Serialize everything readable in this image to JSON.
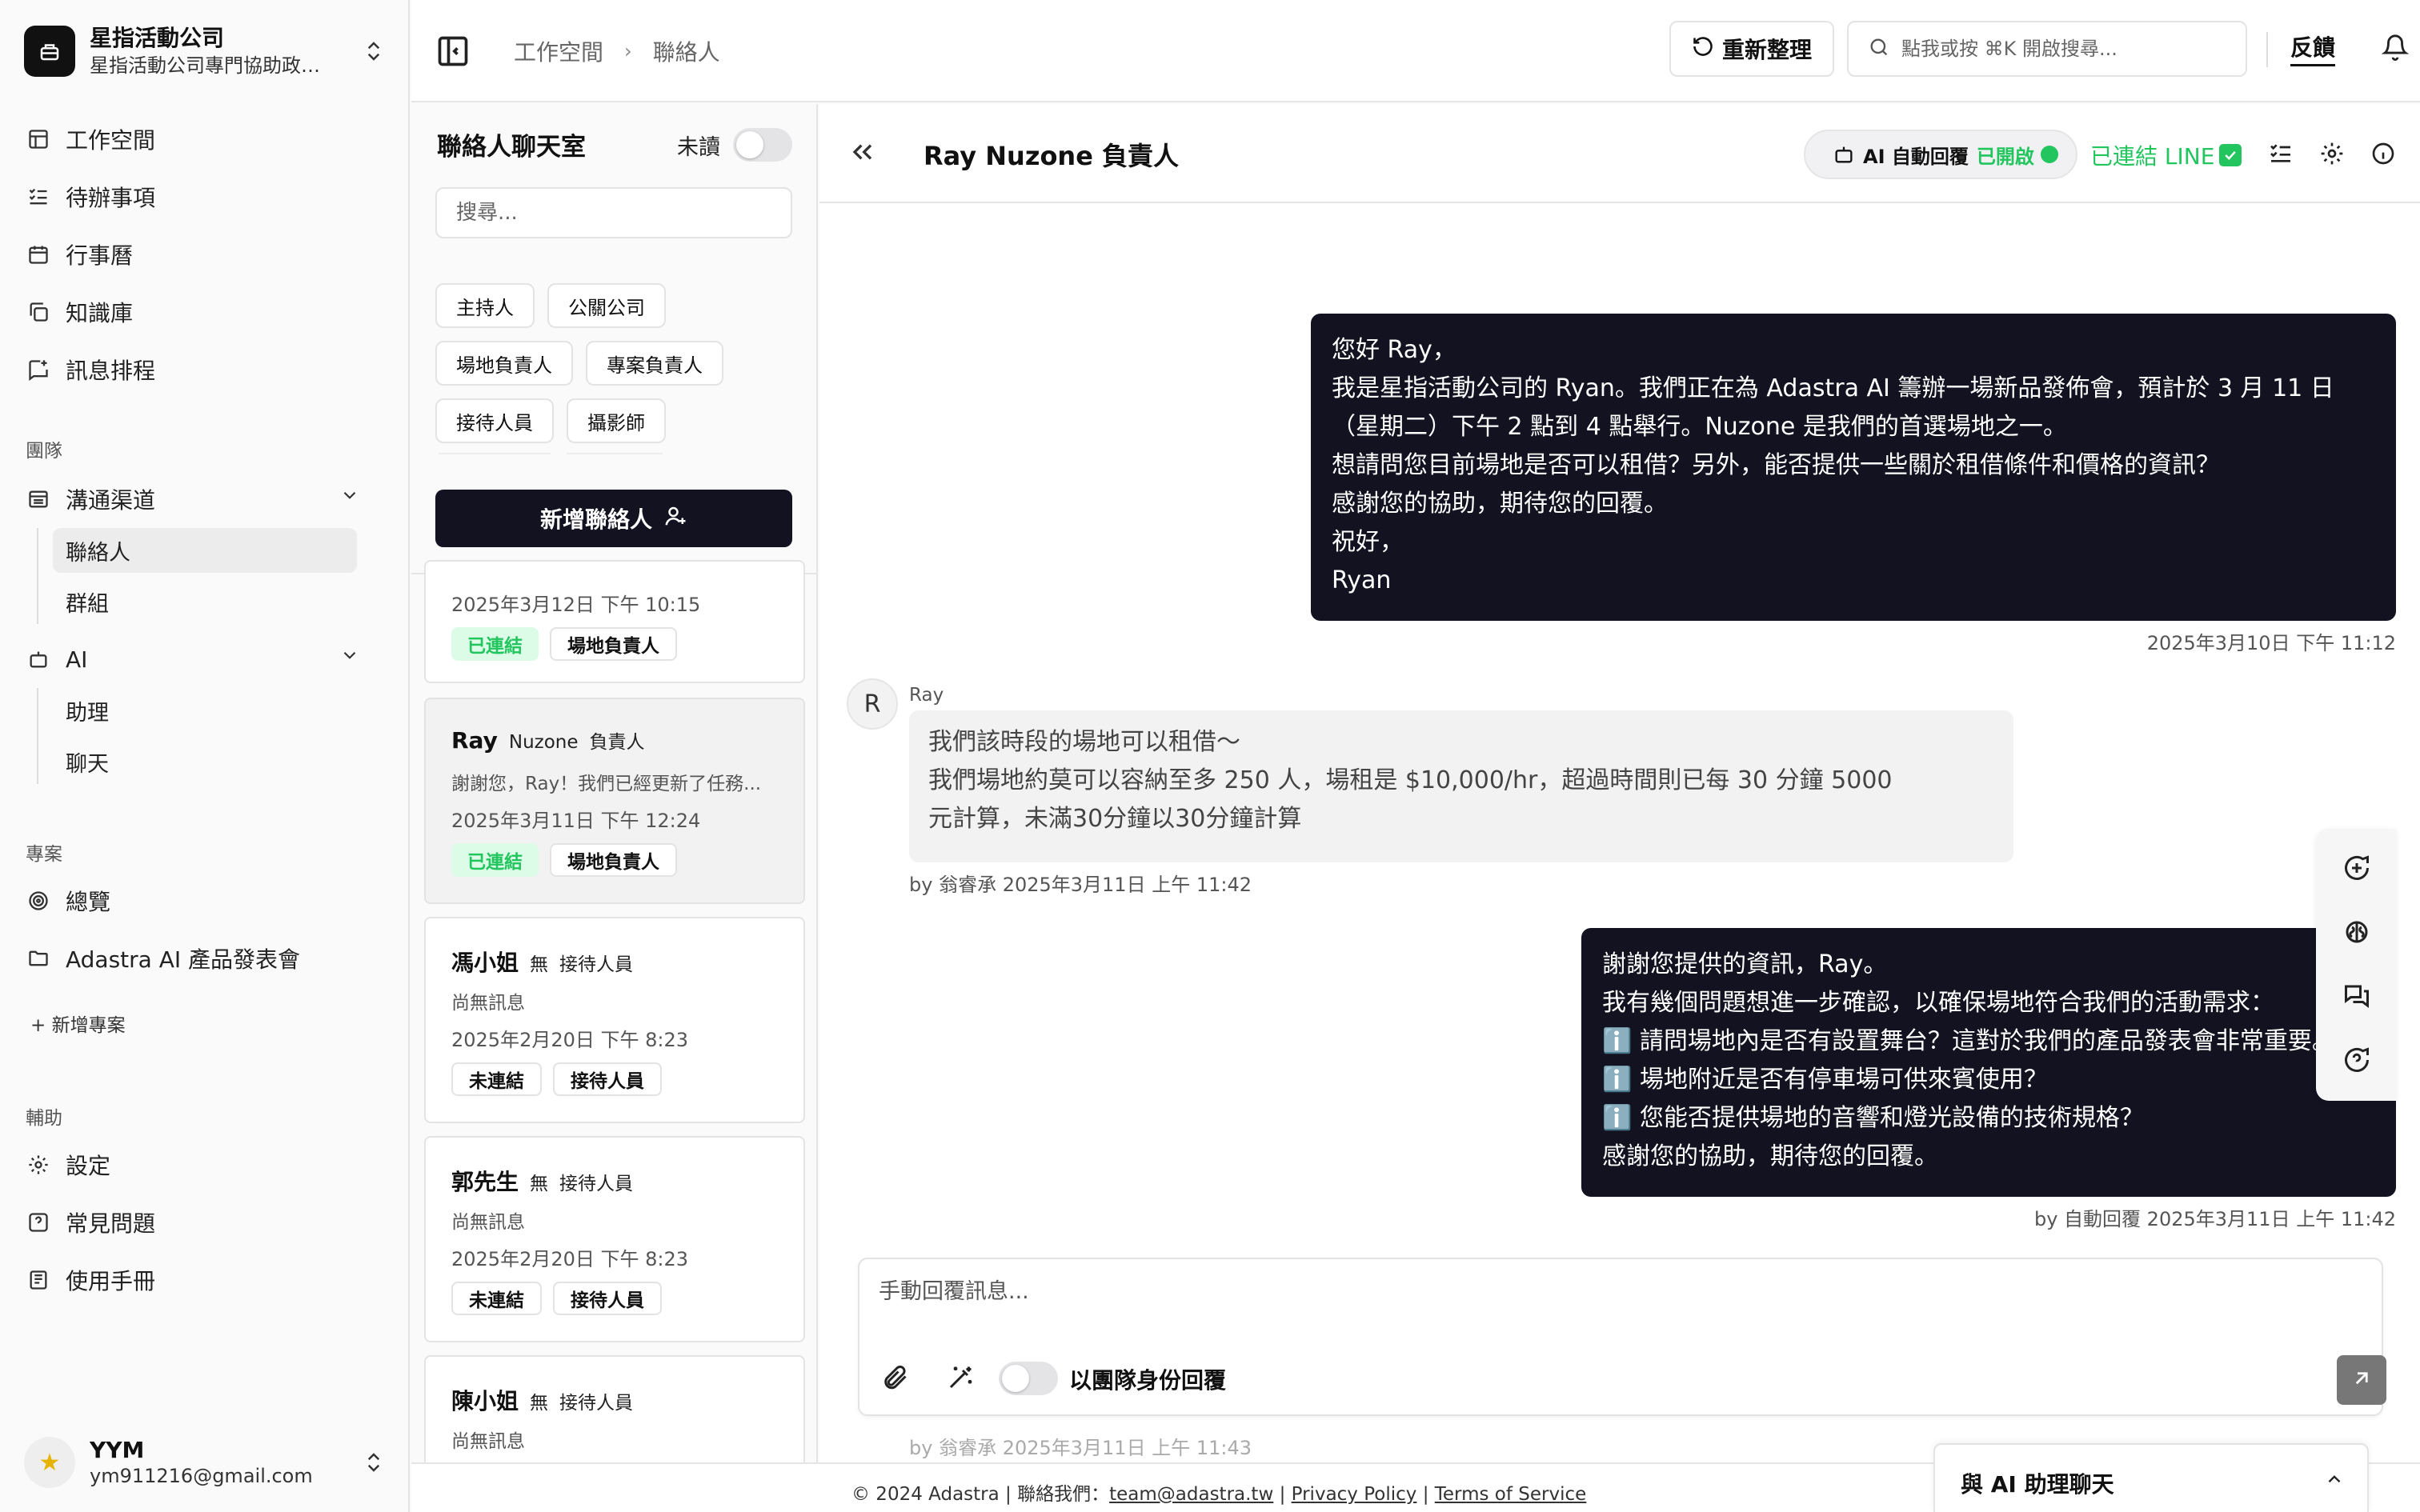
{
  "org": {
    "name": "星指活動公司",
    "description": "星指活動公司專門協助政府..."
  },
  "nav": {
    "workspace": "工作空間",
    "todo": "待辦事項",
    "calendar": "行事曆",
    "knowledge": "知識庫",
    "schedule": "訊息排程",
    "team_section": "團隊",
    "channels": "溝通渠道",
    "contacts": "聯絡人",
    "groups": "群組",
    "ai": "AI",
    "assistant": "助理",
    "chat": "聊天",
    "project_section": "專案",
    "overview": "總覽",
    "project_1": "Adastra AI 產品發表會",
    "add_project": "+ 新增專案",
    "aux_section": "輔助",
    "settings": "設定",
    "faq": "常見問題",
    "manual": "使用手冊"
  },
  "user": {
    "name": "YYM",
    "email": "ym911216@gmail.com"
  },
  "topbar": {
    "breadcrumb": [
      "工作空間",
      "聯絡人"
    ],
    "refresh_label": "重新整理",
    "search_placeholder": "點我或按 ⌘K 開啟搜尋...",
    "feedback_label": "反饋"
  },
  "contact_list": {
    "title": "聯絡人聊天室",
    "unread_label": "未讀",
    "search_placeholder": "搜尋...",
    "filters": [
      "主持人",
      "公關公司",
      "場地負責人",
      "專案負責人",
      "接待人員",
      "攝影師"
    ],
    "add_button": "新增聯絡人",
    "cards": [
      {
        "date": "2025年3月12日 下午 10:15",
        "status": "已連結",
        "role_tag": "場地負責人"
      },
      {
        "name": "Ray",
        "sub": "Nuzone",
        "role": "負責人",
        "preview": "謝謝您，Ray！我們已經更新了任務...",
        "date": "2025年3月11日 下午 12:24",
        "status": "已連結",
        "role_tag": "場地負責人"
      },
      {
        "name": "馮小姐",
        "sub": "無",
        "role": "接待人員",
        "preview": "尚無訊息",
        "date": "2025年2月20日 下午 8:23",
        "status": "未連結",
        "role_tag": "接待人員"
      },
      {
        "name": "郭先生",
        "sub": "無",
        "role": "接待人員",
        "preview": "尚無訊息",
        "date": "2025年2月20日 下午 8:23",
        "status": "未連結",
        "role_tag": "接待人員"
      },
      {
        "name": "陳小姐",
        "sub": "無",
        "role": "接待人員",
        "preview": "尚無訊息"
      }
    ]
  },
  "chat": {
    "title": "Ray Nuzone 負責人",
    "ai_auto_reply": "AI 自動回覆",
    "ai_status": "已開啟",
    "line_status": "已連結 LINE",
    "messages": [
      {
        "lines": [
          "您好 Ray，",
          "我是星指活動公司的 Ryan。我們正在為 Adastra AI 籌辦一場新品發佈會，預計於 3 月 11 日",
          "（星期二）下午 2 點到 4 點舉行。Nuzone 是我們的首選場地之一。",
          "想請問您目前場地是否可以租借？另外，能否提供一些關於租借條件和價格的資訊？",
          "感謝您的協助，期待您的回覆。",
          "祝好，",
          "Ryan"
        ],
        "meta": "2025年3月10日 下午 11:12"
      },
      {
        "sender_initial": "R",
        "sender": "Ray",
        "lines": [
          "我們該時段的場地可以租借～",
          "我們場地約莫可以容納至多 250 人，場租是 $10,000/hr，超過時間則已每 30 分鐘 5000",
          "元計算，未滿30分鐘以30分鐘計算"
        ],
        "meta": "by 翁睿承 2025年3月11日 上午 11:42"
      },
      {
        "lines": [
          "謝謝您提供的資訊，Ray。",
          "我有幾個問題想進一步確認，以確保場地符合我們的活動需求：",
          "ℹ️ 請問場地內是否有設置舞台？這對於我們的產品發表會非常重要。",
          "ℹ️ 場地附近是否有停車場可供來賓使用？",
          "ℹ️ 您能否提供場地的音響和燈光設備的技術規格？",
          "感謝您的協助，期待您的回覆。"
        ],
        "meta": "by 自動回覆 2025年3月11日 上午 11:42"
      }
    ],
    "ghost_meta": "by 翁睿承 2025年3月11日 上午 11:43",
    "composer_placeholder": "手動回覆訊息...",
    "team_reply_label": "以團隊身份回覆"
  },
  "footer": {
    "prefix": "© 2024 Adastra | 聯絡我們：",
    "email": "team@adastra.tw",
    "sep": "|",
    "privacy": "Privacy Policy",
    "terms": "Terms of Service"
  },
  "ai_chat_tab": "與 AI 助理聊天",
  "colors": {
    "dark": "#121221",
    "green": "#22c55e"
  }
}
